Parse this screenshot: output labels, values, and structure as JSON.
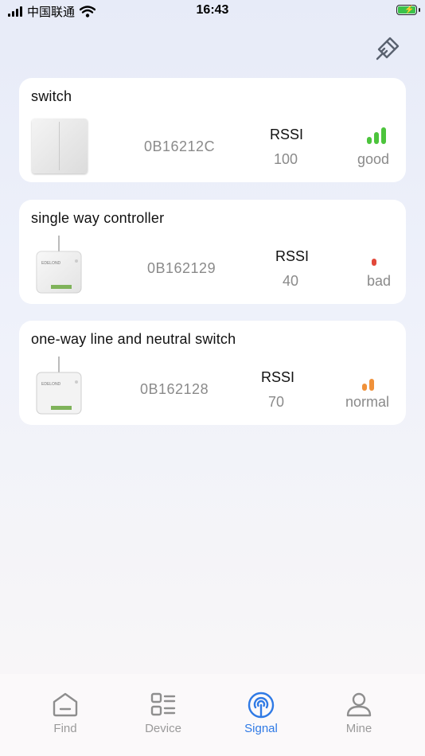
{
  "status_bar": {
    "carrier": "中国联通",
    "time": "16:43",
    "signal_icon": "cellular-signal-icon",
    "wifi_icon": "wifi-icon",
    "battery_icon": "battery-charging-icon",
    "battery_color": "#3bc24a"
  },
  "toolbar": {
    "clean_icon": "brush-clean-icon"
  },
  "devices": [
    {
      "name": "switch",
      "id": "0B16212C",
      "rssi_label": "RSSI",
      "rssi": "100",
      "quality": "good",
      "quality_color": "#4cc43c",
      "bars": 3,
      "image": "wall-switch-image"
    },
    {
      "name": "single way controller",
      "id": "0B162129",
      "rssi_label": "RSSI",
      "rssi": "40",
      "quality": "bad",
      "quality_color": "#e2483a",
      "bars": 1,
      "image": "controller-module-image"
    },
    {
      "name": "one-way line and neutral switch",
      "id": "0B162128",
      "rssi_label": "RSSI",
      "rssi": "70",
      "quality": "normal",
      "quality_color": "#f0913a",
      "bars": 2,
      "image": "controller-module-image"
    }
  ],
  "module_brand": "EDELOND",
  "tabs": [
    {
      "label": "Find",
      "icon": "home-icon",
      "active": false
    },
    {
      "label": "Device",
      "icon": "device-list-icon",
      "active": false
    },
    {
      "label": "Signal",
      "icon": "signal-broadcast-icon",
      "active": true
    },
    {
      "label": "Mine",
      "icon": "person-icon",
      "active": false
    }
  ],
  "colors": {
    "accent": "#2f7ae5",
    "inactive_tab": "#9a9a9a"
  }
}
